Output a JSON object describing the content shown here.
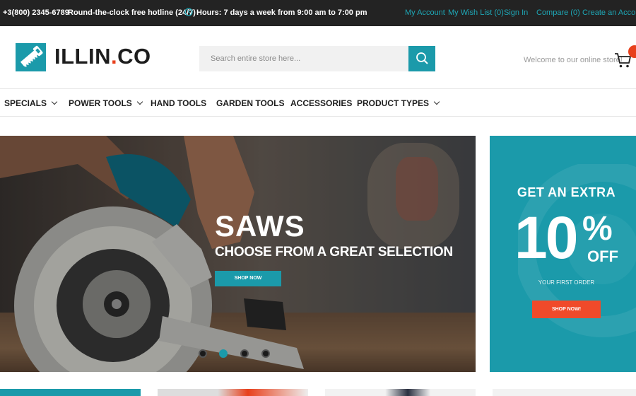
{
  "topbar": {
    "phone": "+3(800) 2345-6789",
    "hotline": "Round-the-clock free hotline (24/7)",
    "hours": "Hours: 7 days a week from 9:00 am to 7:00 pm",
    "links": [
      "My Account",
      "My Wish List (0)",
      "Sign In",
      "Compare (0)",
      "Create an Account"
    ]
  },
  "header": {
    "logo_main": "ILLIN",
    "logo_dot": ".",
    "logo_tail": "CO",
    "search_placeholder": "Search entire store here...",
    "welcome": "Welcome to our online store!"
  },
  "nav": {
    "items": [
      "SPECIALS",
      "POWER TOOLS",
      "HAND TOOLS",
      "GARDEN TOOLS",
      "ACCESSORIES",
      "PRODUCT TYPES"
    ]
  },
  "hero": {
    "title": "SAWS",
    "subtitle": "CHOOSE FROM A GREAT SELECTION",
    "button": "SHOP NOW",
    "slides": 4,
    "active_slide": 2
  },
  "promo": {
    "top": "GET AN EXTRA",
    "big": "10",
    "percent": "%",
    "off": "OFF",
    "sub": "YOUR FIRST ORDER",
    "button": "SHOP NOW!"
  },
  "colors": {
    "accent": "#1b9aaa",
    "orange": "#e8401c",
    "topbar": "#232323"
  },
  "icons": {
    "clock": "clock-icon",
    "search": "search-icon",
    "cart": "cart-icon",
    "logo": "saw-logo-icon"
  }
}
